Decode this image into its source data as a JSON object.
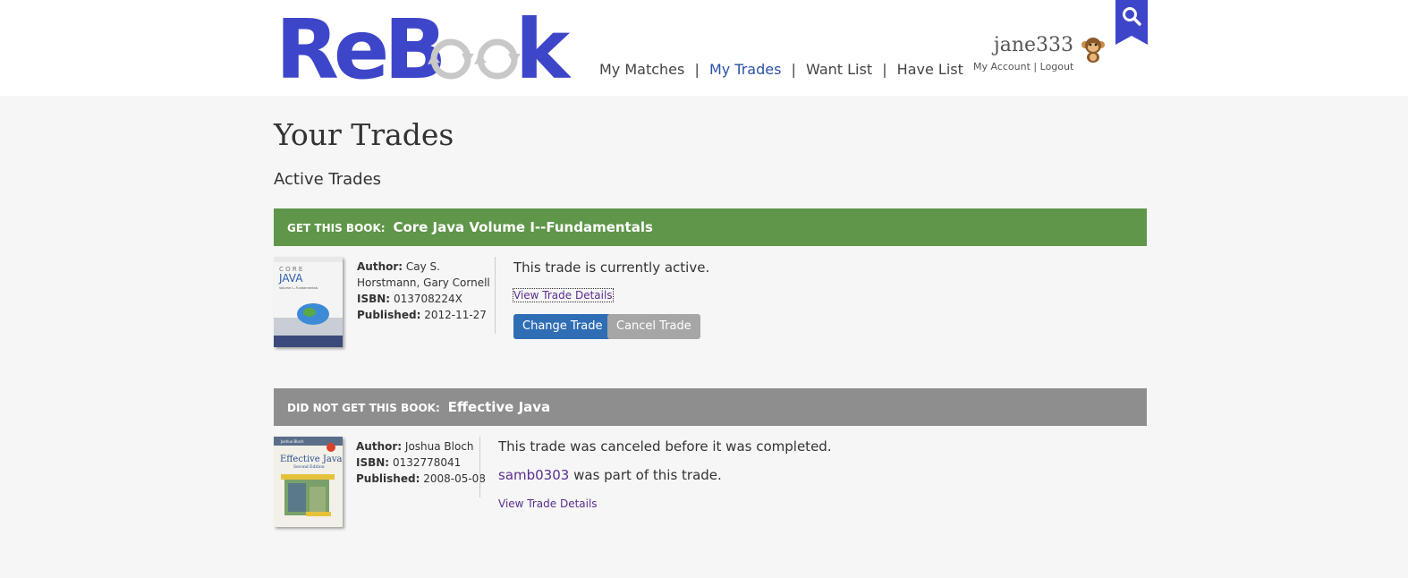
{
  "header": {
    "logo_text": "ReBook",
    "nav": [
      {
        "label": "My Matches",
        "active": false
      },
      {
        "label": "My Trades",
        "active": true
      },
      {
        "label": "Want List",
        "active": false
      },
      {
        "label": "Have List",
        "active": false
      }
    ],
    "nav_separator": "|",
    "username": "jane333",
    "account_link": "My Account",
    "account_sep": "|",
    "logout_link": "Logout",
    "avatar_icon": "monkey-icon",
    "search_icon": "search-icon"
  },
  "main": {
    "page_title": "Your Trades",
    "section_title": "Active Trades",
    "trades": [
      {
        "prefix": "GET THIS BOOK:",
        "title": "Core Java Volume I--Fundamentals",
        "bar_color": "#5f9649",
        "author_label": "Author:",
        "author_line1": "Cay S.",
        "author_line2": "Horstmann, Gary Cornell",
        "isbn_label": "ISBN:",
        "isbn": "013708224X",
        "published_label": "Published:",
        "published": "2012-11-27",
        "status": "This trade is currently active.",
        "details_link": "View Trade Details",
        "change_button": "Change Trade",
        "cancel_button": "Cancel Trade"
      },
      {
        "prefix": "DID NOT GET THIS BOOK:",
        "title": "Effective Java",
        "bar_color": "#8e8e8e",
        "author_label": "Author:",
        "author": "Joshua Bloch",
        "isbn_label": "ISBN:",
        "isbn": "0132778041",
        "published_label": "Published:",
        "published": "2008-05-08",
        "status": "This trade was canceled before it was completed.",
        "partner_user": "samb0303",
        "partner_text": "was part of this trade.",
        "details_link": "View Trade Details"
      }
    ]
  }
}
